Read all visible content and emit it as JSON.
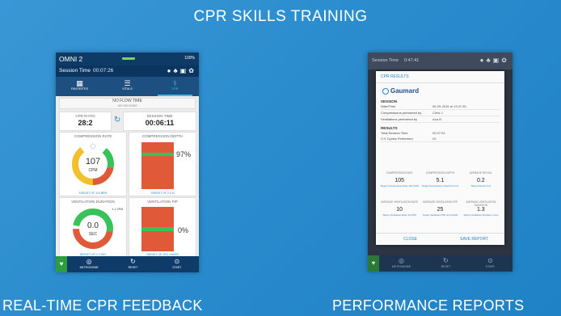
{
  "banner": {
    "title": "CPR SKILLS TRAINING"
  },
  "captions": {
    "left": "REAL-TIME CPR FEEDBACK",
    "right": "PERFORMANCE REPORTS"
  },
  "colors": {
    "background": "#2a8ccd",
    "accent": "#36c0f1",
    "gauge_green": "#39c259",
    "gauge_red": "#e05a3a",
    "gauge_yellow": "#f2c02a"
  },
  "left_tablet": {
    "status": {
      "app_name": "OMNI 2",
      "battery": "100%"
    },
    "session": {
      "label": "Session Time",
      "value": "00:07:26"
    },
    "nav_tabs": [
      {
        "label": "FAVORITES",
        "icon": "grid-icon"
      },
      {
        "label": "VITALS",
        "icon": "sliders-icon"
      },
      {
        "label": "CPR",
        "icon": "cpr-icon"
      }
    ],
    "no_flow": {
      "title": "NO FLOW TIME",
      "sub": "000 SECONDS"
    },
    "cpr_ratio": {
      "label": "CPR RATIO",
      "value": "28:2"
    },
    "session_time": {
      "label": "SESSION TIME",
      "value": "00:06:11"
    },
    "compression_rate": {
      "label": "COMPRESSION RATE",
      "value": "107",
      "unit": "CPM",
      "target": "TARGET OF 110 BPM"
    },
    "compression_depth": {
      "label": "COMPRESSION DEPTH",
      "value": "97%",
      "target": "TARGET OF 2.0 in"
    },
    "ventilation_duration": {
      "label": "VENTILATION DURATION",
      "value": "0.0",
      "unit": "SEC",
      "marker": "1.1 VPM",
      "target": "TARGET OF 1.0 SEC"
    },
    "ventilation_pip": {
      "label": "VENTILATION PIP",
      "value": "0%",
      "target": "TARGET OF 25.0 cmH2O"
    },
    "bottom_bar": [
      {
        "label": "METRONOME",
        "icon": "metronome-icon"
      },
      {
        "label": "RESET",
        "icon": "reset-icon"
      },
      {
        "label": "START",
        "icon": "play-icon"
      }
    ]
  },
  "right_tablet": {
    "session": {
      "label": "Session Time",
      "value": "0:47:41"
    },
    "dialog": {
      "title": "CPR RESULTS",
      "logo": "Gaumard",
      "session_heading": "SESSION",
      "session_rows": [
        {
          "key": "Date/Time",
          "value": "06-29-2016 at 13:47:35"
        },
        {
          "key": "Compressions performed by",
          "value": "Chris J."
        },
        {
          "key": "Ventilations performed by",
          "value": "Ana B."
        }
      ],
      "results_heading": "RESULTS",
      "results_rows": [
        {
          "key": "Total Session Time",
          "value": "00:07:04"
        },
        {
          "key": "C:V Cycles Performed",
          "value": "29"
        }
      ],
      "metrics_row1": [
        {
          "label": "COMPRESSION RATE",
          "value": "105",
          "target": "Target Compression Rate 100 CPM"
        },
        {
          "label": "COMPRESSION DEPTH",
          "value": "5.1",
          "target": "Target Compression Depth 5.0 cm"
        },
        {
          "label": "AVERAGE RECOIL",
          "value": "0.2",
          "target": "Target Recoil 0 cm"
        }
      ],
      "metrics_row2": [
        {
          "label": "AVERAGE VENTILATION RATE",
          "value": "10",
          "target": "Target Ventilation Rate 10 VPM"
        },
        {
          "label": "AVERAGE VENTILATION PIP",
          "value": "25",
          "target": "Target Ventilation PIP 11 cmH2O"
        },
        {
          "label": "AVERAGE VENTILATION DURATION",
          "value": "1.3",
          "target": "Target Ventilation Duration 1 sec"
        }
      ],
      "close_label": "CLOSE",
      "save_label": "SAVE REPORT"
    },
    "bottom_bar": [
      {
        "label": "METRONOME",
        "icon": "metronome-icon"
      },
      {
        "label": "RESET",
        "icon": "reset-icon"
      },
      {
        "label": "START",
        "icon": "play-icon"
      }
    ]
  }
}
